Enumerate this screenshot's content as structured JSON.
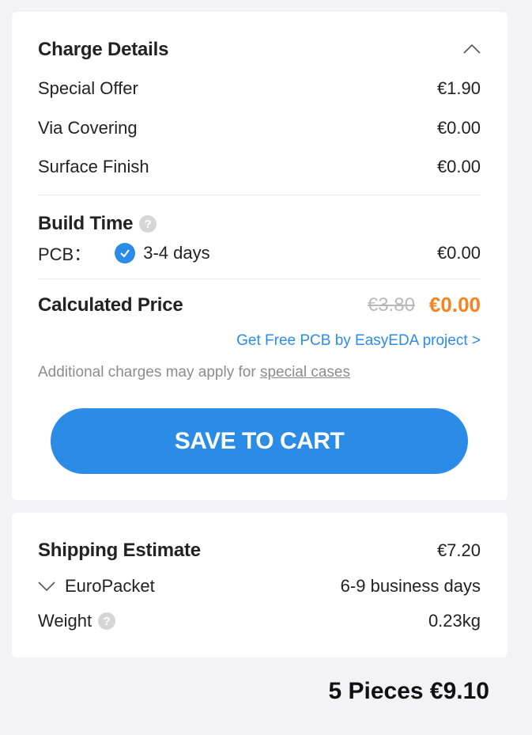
{
  "charge_details": {
    "title": "Charge Details",
    "toggle_icon": "chevron-up-icon",
    "items": [
      {
        "label": "Special Offer",
        "value": "€1.90"
      },
      {
        "label": "Via Covering",
        "value": "€0.00"
      },
      {
        "label": "Surface Finish",
        "value": "€0.00"
      }
    ],
    "build_time": {
      "title": "Build Time",
      "help_icon": "question-icon",
      "pcb_label": "PCB：",
      "selected_option": "3-4 days",
      "value": "€0.00"
    },
    "calculated_price": {
      "label": "Calculated Price",
      "old_price": "€3.80",
      "new_price": "€0.00"
    },
    "promo_link": "Get Free PCB by EasyEDA project >",
    "note": {
      "text": "Additional charges may apply for ",
      "link": "special cases"
    },
    "save_button": "SAVE TO CART"
  },
  "shipping": {
    "title": "Shipping Estimate",
    "cost": "€7.20",
    "method": "EuroPacket",
    "method_time": "6-9 business days",
    "weight_label": "Weight",
    "weight_value": "0.23kg"
  },
  "total": "5 Pieces €9.10",
  "colors": {
    "accent": "#2b8ce8",
    "price_highlight": "#f7831e",
    "background": "#f3f3f5"
  }
}
